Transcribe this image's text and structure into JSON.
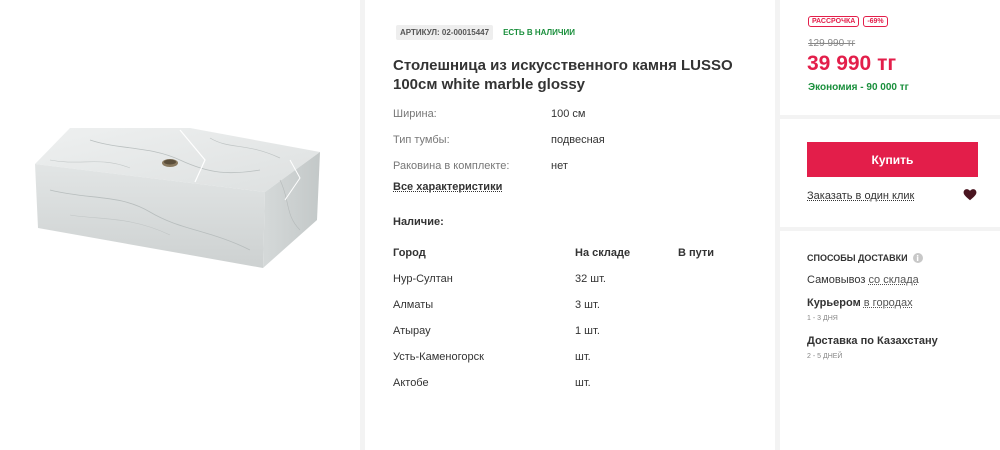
{
  "product": {
    "sku": "АРТИКУЛ: 02-00015447",
    "stock_status": "ЕСТЬ В НАЛИЧИИ",
    "title": "Столешница из искусственного камня LUSSO 100см white marble glossy",
    "specs": [
      {
        "label": "Ширина:",
        "value": "100 см"
      },
      {
        "label": "Тип тумбы:",
        "value": "подвесная"
      },
      {
        "label": "Раковина в комплекте:",
        "value": "нет"
      }
    ],
    "all_specs_link": "Все характеристики"
  },
  "availability": {
    "title": "Наличие:",
    "headers": {
      "city": "Город",
      "in_store": "На складе",
      "in_transit": "В пути"
    },
    "rows": [
      {
        "city": "Нур-Султан",
        "in_store": "32 шт.",
        "in_transit": ""
      },
      {
        "city": "Алматы",
        "in_store": "3 шт.",
        "in_transit": ""
      },
      {
        "city": "Атырау",
        "in_store": "1 шт.",
        "in_transit": ""
      },
      {
        "city": "Усть-Каменогорск",
        "in_store": "шт.",
        "in_transit": ""
      },
      {
        "city": "Актобе",
        "in_store": "шт.",
        "in_transit": ""
      }
    ]
  },
  "price": {
    "installment_badge": "РАССРОЧКА",
    "discount_badge": "-69%",
    "old_price": "129 990 тг",
    "new_price": "39 990 тг",
    "saving": "Экономия - 90 000 тг"
  },
  "buy": {
    "buy_label": "Купить",
    "one_click_label": "Заказать в один клик"
  },
  "delivery": {
    "title": "СПОСОБЫ ДОСТАВКИ",
    "info_icon": "i",
    "pickup": {
      "label": "Самовывоз",
      "link": "со склада"
    },
    "courier": {
      "label": "Курьером",
      "link": "в городах",
      "note": "1 - 3 ДНЯ"
    },
    "country": {
      "label": "Доставка по Казахстану",
      "note": "2 - 5 ДНЕЙ"
    }
  },
  "colors": {
    "accent": "#e31e4a",
    "success": "#1a8f3c",
    "background": "#f3f3f3"
  }
}
